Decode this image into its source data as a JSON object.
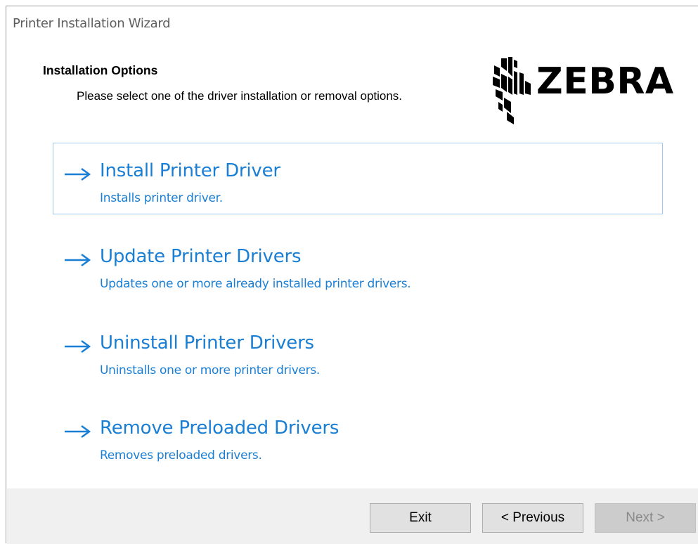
{
  "window": {
    "title": "Printer Installation Wizard"
  },
  "header": {
    "title": "Installation Options",
    "description": "Please select one of the driver installation or removal options."
  },
  "logo": {
    "text": "ZEBRA",
    "icon": "zebra-head-logo"
  },
  "options": [
    {
      "icon": "arrow-right-icon",
      "title": "Install Printer Driver",
      "description": "Installs printer driver.",
      "selected": true
    },
    {
      "icon": "arrow-right-icon",
      "title": "Update Printer Drivers",
      "description": "Updates one or more already installed printer drivers.",
      "selected": false
    },
    {
      "icon": "arrow-right-icon",
      "title": "Uninstall Printer Drivers",
      "description": "Uninstalls one or more printer drivers.",
      "selected": false
    },
    {
      "icon": "arrow-right-icon",
      "title": "Remove Preloaded Drivers",
      "description": "Removes preloaded drivers.",
      "selected": false
    }
  ],
  "footer": {
    "exit_label": "Exit",
    "previous_label": "< Previous",
    "next_label": "Next >",
    "next_enabled": false
  },
  "colors": {
    "link": "#1a7fd4",
    "selection_border": "#9ec8ec",
    "footer_bg": "#f0f0f0"
  }
}
